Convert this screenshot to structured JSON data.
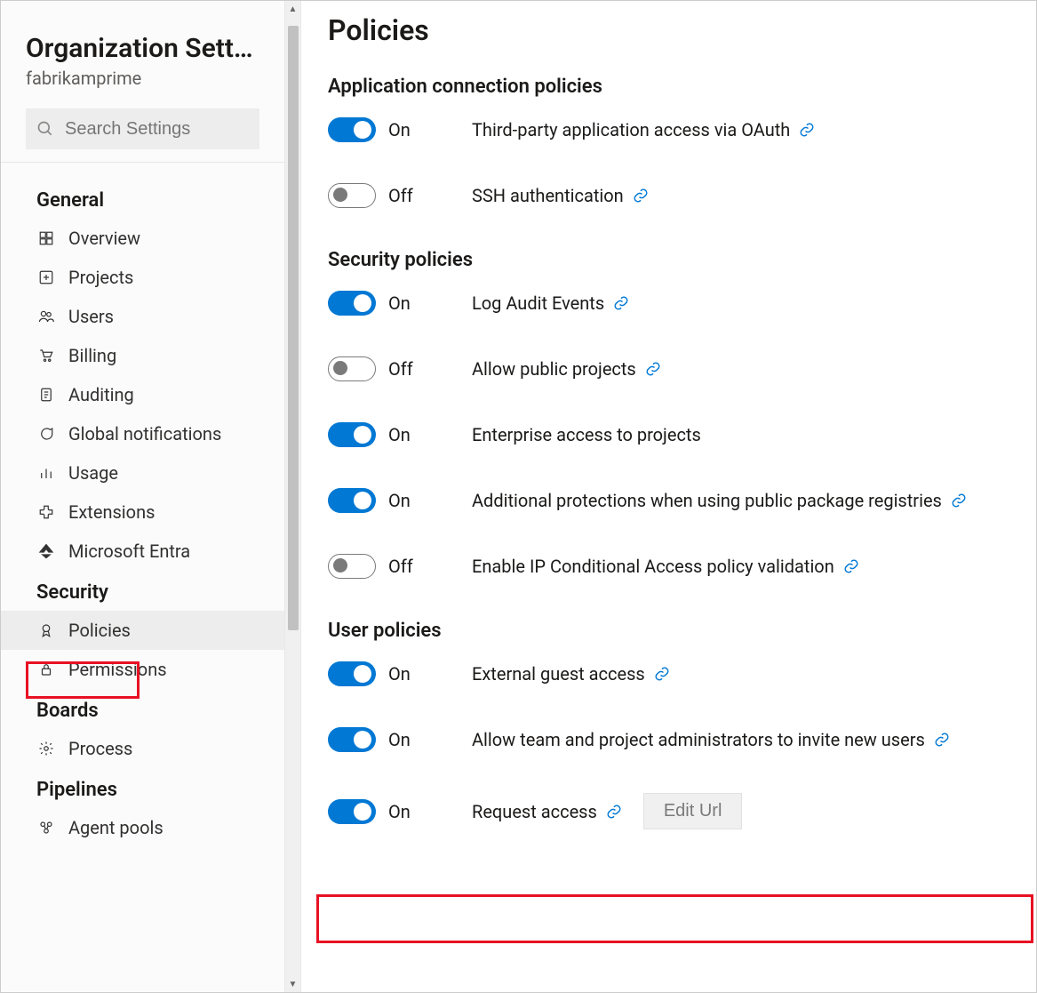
{
  "sidebar": {
    "title": "Organization Settin…",
    "subtitle": "fabrikamprime",
    "search_placeholder": "Search Settings",
    "groups": [
      {
        "title": "General",
        "items": [
          {
            "id": "overview",
            "label": "Overview",
            "icon": "dashboard-icon"
          },
          {
            "id": "projects",
            "label": "Projects",
            "icon": "new-item-icon"
          },
          {
            "id": "users",
            "label": "Users",
            "icon": "people-icon"
          },
          {
            "id": "billing",
            "label": "Billing",
            "icon": "cart-icon"
          },
          {
            "id": "auditing",
            "label": "Auditing",
            "icon": "log-icon"
          },
          {
            "id": "global-notifications",
            "label": "Global notifications",
            "icon": "chat-icon"
          },
          {
            "id": "usage",
            "label": "Usage",
            "icon": "bar-chart-icon"
          },
          {
            "id": "extensions",
            "label": "Extensions",
            "icon": "puzzle-icon"
          },
          {
            "id": "microsoft-entra",
            "label": "Microsoft Entra",
            "icon": "entra-icon"
          }
        ]
      },
      {
        "title": "Security",
        "items": [
          {
            "id": "policies",
            "label": "Policies",
            "icon": "ribbon-icon",
            "selected": true,
            "highlighted": true
          },
          {
            "id": "permissions",
            "label": "Permissions",
            "icon": "lock-icon"
          }
        ]
      },
      {
        "title": "Boards",
        "items": [
          {
            "id": "process",
            "label": "Process",
            "icon": "gear-icon"
          }
        ]
      },
      {
        "title": "Pipelines",
        "items": [
          {
            "id": "agent-pools",
            "label": "Agent pools",
            "icon": "pools-icon"
          }
        ]
      }
    ]
  },
  "main": {
    "page_title": "Policies",
    "toggle_labels": {
      "on": "On",
      "off": "Off"
    },
    "sections": [
      {
        "title": "Application connection policies",
        "policies": [
          {
            "id": "oauth",
            "label": "Third-party application access via OAuth",
            "state": "on",
            "link": true
          },
          {
            "id": "ssh",
            "label": "SSH authentication",
            "state": "off",
            "link": true
          }
        ]
      },
      {
        "title": "Security policies",
        "policies": [
          {
            "id": "audit",
            "label": "Log Audit Events",
            "state": "on",
            "link": true
          },
          {
            "id": "public-projects",
            "label": "Allow public projects",
            "state": "off",
            "link": true
          },
          {
            "id": "enterprise-access",
            "label": "Enterprise access to projects",
            "state": "on",
            "link": false
          },
          {
            "id": "public-pkg",
            "label": "Additional protections when using public package registries",
            "state": "on",
            "link": true
          },
          {
            "id": "ip-cap",
            "label": "Enable IP Conditional Access policy validation",
            "state": "off",
            "link": true
          }
        ]
      },
      {
        "title": "User policies",
        "policies": [
          {
            "id": "guest-access",
            "label": "External guest access",
            "state": "on",
            "link": true
          },
          {
            "id": "invite-users",
            "label": "Allow team and project administrators to invite new users",
            "state": "on",
            "link": true
          },
          {
            "id": "request-access",
            "label": "Request access",
            "state": "on",
            "link": true,
            "edit_url": "Edit Url",
            "highlighted": true
          }
        ]
      }
    ]
  }
}
